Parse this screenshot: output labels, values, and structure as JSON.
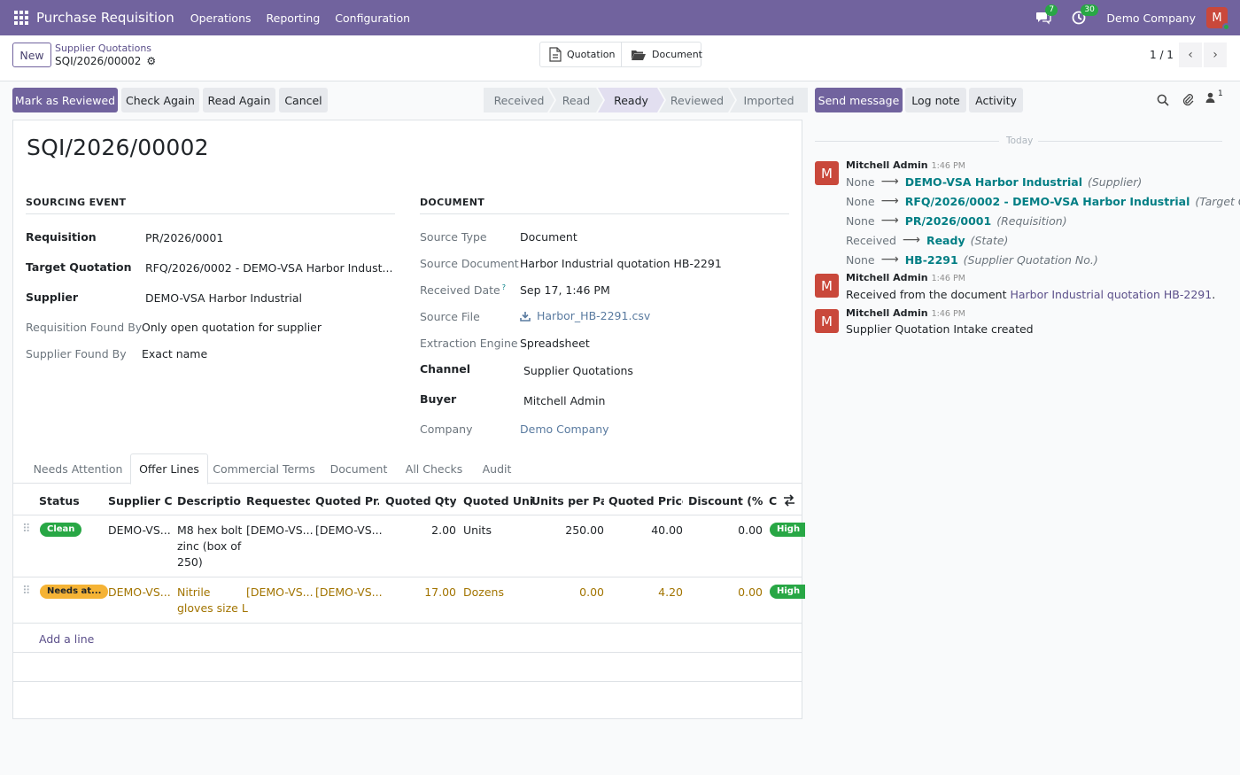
{
  "topbar": {
    "app_title": "Purchase Requisition",
    "menus": [
      "Operations",
      "Reporting",
      "Configuration"
    ],
    "messages_count": "7",
    "activities_count": "30",
    "company": "Demo Company",
    "user_initial": "M"
  },
  "control_panel": {
    "new_label": "New",
    "breadcrumb_parent": "Supplier Quotations",
    "breadcrumb_current": "SQI/2026/00002",
    "smart_buttons": [
      "Quotation",
      "Document"
    ],
    "pager": "1 / 1"
  },
  "actions": {
    "mark_reviewed": "Mark as Reviewed",
    "check_again": "Check Again",
    "read_again": "Read Again",
    "cancel": "Cancel"
  },
  "statusbar": {
    "stages": [
      "Received",
      "Read",
      "Ready",
      "Reviewed",
      "Imported"
    ],
    "active": "Ready"
  },
  "record": {
    "title": "SQI/2026/00002",
    "sourcing_event": {
      "section_title": "SOURCING EVENT",
      "requisition_label": "Requisition",
      "requisition": "PR/2026/0001",
      "target_quotation_label": "Target Quotation",
      "target_quotation": "RFQ/2026/0002 - DEMO-VSA Harbor Indust...",
      "supplier_label": "Supplier",
      "supplier": "DEMO-VSA Harbor Industrial",
      "req_found_by_label": "Requisition Found By",
      "req_found_by": "Only open quotation for supplier",
      "sup_found_by_label": "Supplier Found By",
      "sup_found_by": "Exact name"
    },
    "document": {
      "section_title": "DOCUMENT",
      "source_type_label": "Source Type",
      "source_type": "Document",
      "source_document_label": "Source Document",
      "source_document": "Harbor Industrial quotation HB-2291",
      "received_date_label": "Received Date",
      "received_date_help": "?",
      "received_date": "Sep 17, 1:46 PM",
      "source_file_label": "Source File",
      "source_file": "Harbor_HB-2291.csv",
      "extraction_engine_label": "Extraction Engine",
      "extraction_engine": "Spreadsheet",
      "channel_label": "Channel",
      "channel": "Supplier Quotations",
      "buyer_label": "Buyer",
      "buyer": "Mitchell Admin",
      "company_label": "Company",
      "company": "Demo Company"
    }
  },
  "tabs": [
    "Needs Attention",
    "Offer Lines",
    "Commercial Terms",
    "Document",
    "All Checks",
    "Audit"
  ],
  "lines": {
    "headers": [
      "Status",
      "Supplier C...",
      "Descriptio...",
      "Requested...",
      "Quoted Pr...",
      "Quoted Qty",
      "Quoted Unit",
      "Units per Pack",
      "Quoted Price",
      "Discount (%)",
      "C"
    ],
    "rows": [
      {
        "status": "Clean",
        "supplier_code": "DEMO-VS...",
        "description": [
          "M8 hex bolt",
          "zinc (box of",
          "250)"
        ],
        "requested": "[DEMO-VS...",
        "quoted_product": "[DEMO-VS...",
        "qty": "2.00",
        "unit": "Units",
        "units_per_pack": "250.00",
        "price": "40.00",
        "discount": "0.00",
        "confidence": "High"
      },
      {
        "status": "Needs at...",
        "supplier_code": "DEMO-VS...",
        "description": [
          "Nitrile",
          "gloves size L"
        ],
        "requested": "[DEMO-VS...",
        "quoted_product": "[DEMO-VS...",
        "qty": "17.00",
        "unit": "Dozens",
        "units_per_pack": "0.00",
        "price": "4.20",
        "discount": "0.00",
        "confidence": "High"
      }
    ],
    "add_line": "Add a line"
  },
  "chatter": {
    "send_message": "Send message",
    "log_note": "Log note",
    "activity": "Activity",
    "attachments_count": "1",
    "today": "Today",
    "messages": [
      {
        "author": "Mitchell Admin",
        "time": "1:46 PM",
        "tracking": [
          {
            "old": "None",
            "new": "DEMO-VSA Harbor Industrial",
            "field": "(Supplier)"
          },
          {
            "old": "None",
            "new": "RFQ/2026/0002 - DEMO-VSA Harbor Industrial",
            "field": "(Target Quotation)"
          },
          {
            "old": "None",
            "new": "PR/2026/0001",
            "field": "(Requisition)"
          },
          {
            "old": "Received",
            "new": "Ready",
            "field": "(State)"
          },
          {
            "old": "None",
            "new": "HB-2291",
            "field": "(Supplier Quotation No.)"
          }
        ]
      },
      {
        "author": "Mitchell Admin",
        "time": "1:46 PM",
        "body_prefix": "Received from the document ",
        "body_link": "Harbor Industrial quotation HB-2291",
        "body_suffix": "."
      },
      {
        "author": "Mitchell Admin",
        "time": "1:46 PM",
        "body": "Supplier Quotation Intake created"
      }
    ]
  },
  "colors": {
    "brand": "#71639e",
    "avatar": "#c9483b",
    "badge_green": "#28a745",
    "badge_yellow": "#f5b335",
    "warning_text": "#a27400",
    "link_teal": "#017e84"
  }
}
